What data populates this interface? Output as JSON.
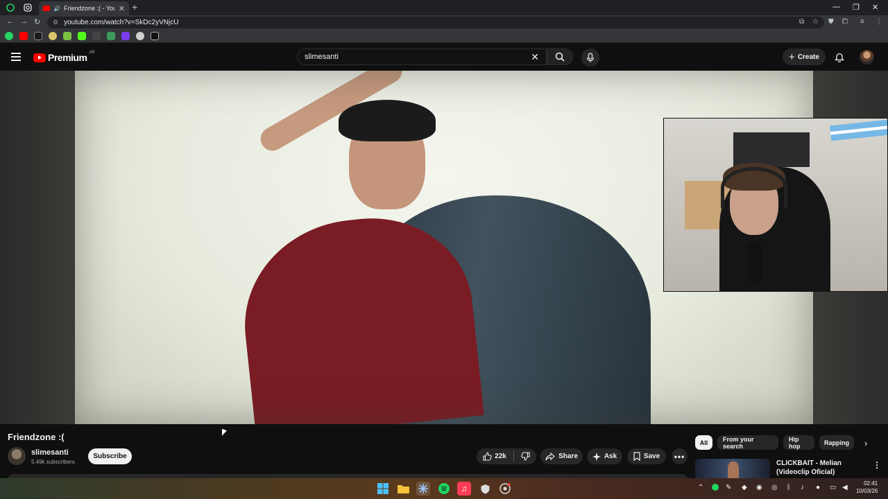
{
  "browser": {
    "tab_title": "Friendzone :( - YouTube",
    "url": "youtube.com/watch?v=SkDc2yVNjcU",
    "new_tab": "+",
    "tab_close": "✕"
  },
  "masthead": {
    "brand": "Premium",
    "country_code": "AR",
    "search_value": "slimesanti",
    "create_label": "Create"
  },
  "video": {
    "title": "Friendzone :("
  },
  "channel": {
    "name": "slimesanti",
    "subscribers": "5.49k subscribers",
    "subscribe_label": "Subscribe"
  },
  "actions": {
    "likes": "22k",
    "share_label": "Share",
    "ask_label": "Ask",
    "save_label": "Save",
    "more": "•••"
  },
  "chips": [
    "All",
    "From your search",
    "Hip hop",
    "Rapping"
  ],
  "recommendation": {
    "title": "CLICKBAIT - Melian (Videoclip Oficial)"
  },
  "system": {
    "time": "02:41",
    "date": "10/03/26"
  },
  "colors": {
    "youtube_red": "#ff0000",
    "background": "#0f0f0f",
    "pill_bg": "#272727"
  }
}
